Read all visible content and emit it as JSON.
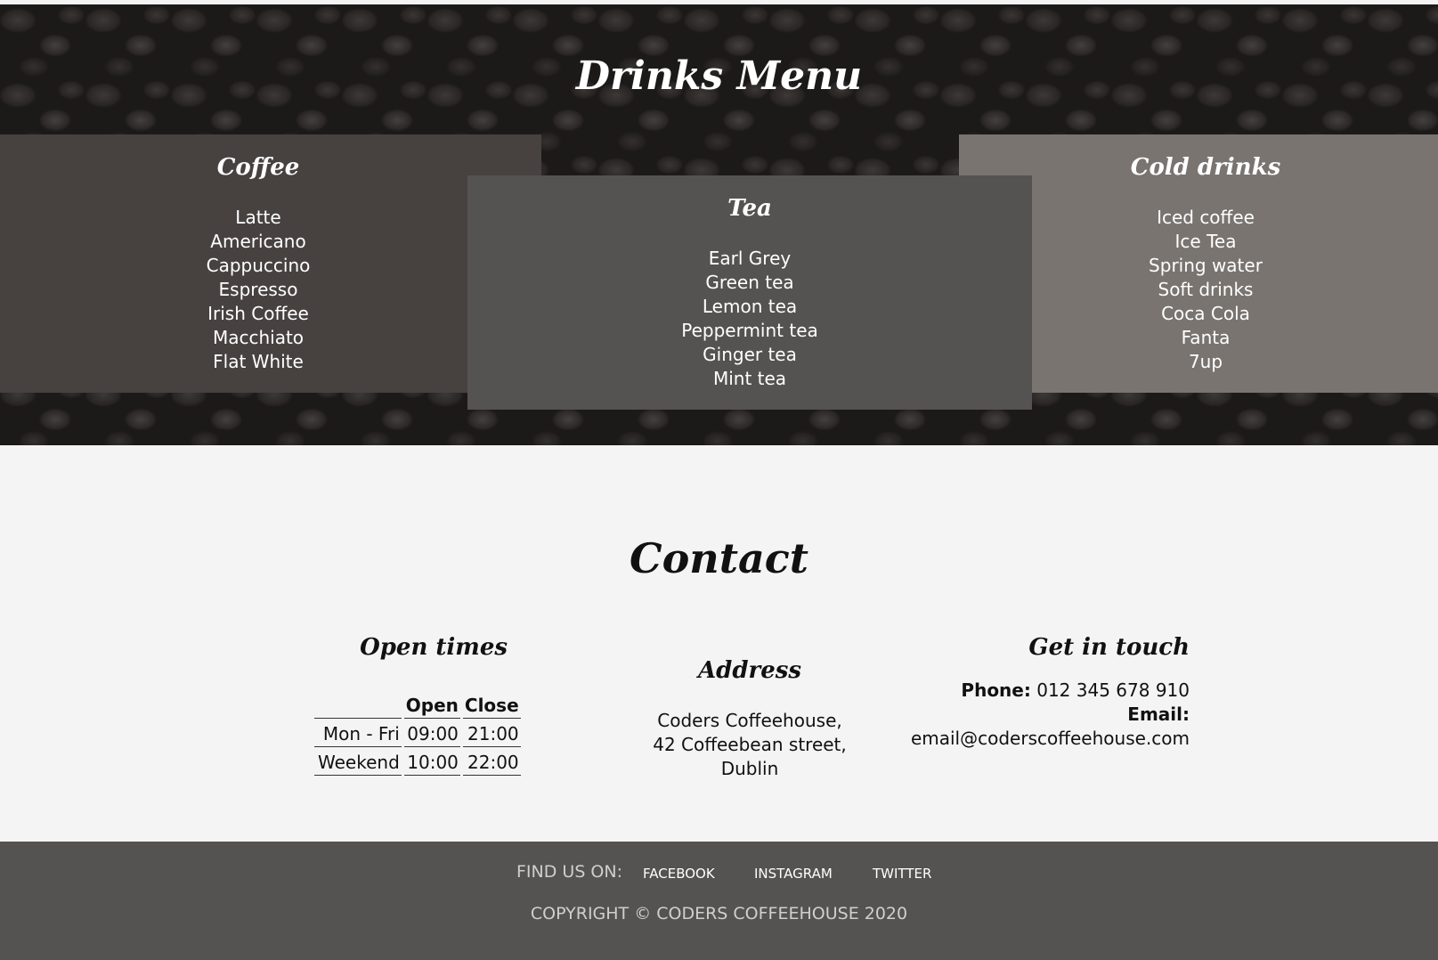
{
  "menu": {
    "title": "Drinks Menu",
    "coffee": {
      "title": "Coffee",
      "items": [
        "Latte",
        "Americano",
        "Cappuccino",
        "Espresso",
        "Irish Coffee",
        "Macchiato",
        "Flat White"
      ]
    },
    "tea": {
      "title": "Tea",
      "items": [
        "Earl Grey",
        "Green tea",
        "Lemon tea",
        "Peppermint tea",
        "Ginger tea",
        "Mint tea"
      ]
    },
    "cold": {
      "title": "Cold drinks",
      "items": [
        "Iced coffee",
        "Ice Tea",
        "Spring water",
        "Soft drinks",
        "Coca Cola",
        "Fanta",
        "7up"
      ]
    }
  },
  "contact": {
    "title": "Contact",
    "open_times": {
      "title": "Open times",
      "headers": [
        "",
        "Open",
        "Close"
      ],
      "rows": [
        [
          "Mon - Fri",
          "09:00",
          "21:00"
        ],
        [
          "Weekend",
          "10:00",
          "22:00"
        ]
      ]
    },
    "address": {
      "title": "Address",
      "lines": [
        "Coders Coffeehouse,",
        "42 Coffeebean street,",
        "Dublin"
      ]
    },
    "get_in_touch": {
      "title": "Get in touch",
      "phone_label": "Phone:",
      "phone": "012 345 678 910",
      "email_label": "Email:",
      "email": "email@coderscoffeehouse.com"
    }
  },
  "footer": {
    "find_us": "FIND US ON:",
    "links": [
      "FACEBOOK",
      "INSTAGRAM",
      "TWITTER"
    ],
    "copyright": "COPYRIGHT © CODERS COFFEEHOUSE 2020"
  }
}
